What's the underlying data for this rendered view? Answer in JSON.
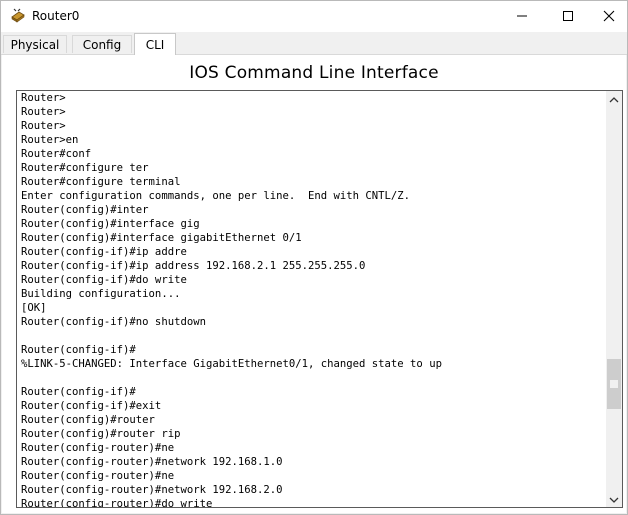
{
  "window": {
    "title": "Router0"
  },
  "controls": {
    "minimize": "minimize-icon",
    "maximize": "maximize-icon",
    "close": "close-icon"
  },
  "tabs": [
    {
      "label": "Physical",
      "selected": false
    },
    {
      "label": "Config",
      "selected": false
    },
    {
      "label": "CLI",
      "selected": true
    }
  ],
  "cli": {
    "header": "IOS Command Line Interface",
    "lines": [
      "Router>",
      "Router>",
      "Router>",
      "Router>en",
      "Router#conf",
      "Router#configure ter",
      "Router#configure terminal",
      "Enter configuration commands, one per line.  End with CNTL/Z.",
      "Router(config)#inter",
      "Router(config)#interface gig",
      "Router(config)#interface gigabitEthernet 0/1",
      "Router(config-if)#ip addre",
      "Router(config-if)#ip address 192.168.2.1 255.255.255.0",
      "Router(config-if)#do write",
      "Building configuration...",
      "[OK]",
      "Router(config-if)#no shutdown",
      "",
      "Router(config-if)#",
      "%LINK-5-CHANGED: Interface GigabitEthernet0/1, changed state to up",
      "",
      "Router(config-if)#",
      "Router(config-if)#exit",
      "Router(config)#router",
      "Router(config)#router rip",
      "Router(config-router)#ne",
      "Router(config-router)#network 192.168.1.0",
      "Router(config-router)#ne",
      "Router(config-router)#network 192.168.2.0",
      "Router(config-router)#do write"
    ]
  },
  "scrollbar": {
    "position": 0.86
  }
}
